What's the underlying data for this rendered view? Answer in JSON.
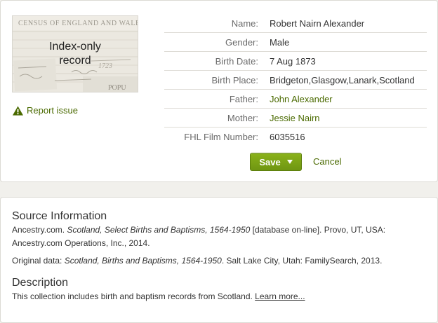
{
  "thumbnail": {
    "label": "Index-only record",
    "census_text": "CENSUS OF ENGLAND AND WALES,",
    "scrap_text_1": "POPU",
    "scrap_text_2": "1723"
  },
  "report": {
    "label": "Report issue",
    "icon": "warning-icon"
  },
  "record": {
    "fields": [
      {
        "label": "Name:",
        "value": "Robert Nairn Alexander",
        "link": false
      },
      {
        "label": "Gender:",
        "value": "Male",
        "link": false
      },
      {
        "label": "Birth Date:",
        "value": "7 Aug 1873",
        "link": false
      },
      {
        "label": "Birth Place:",
        "value": "Bridgeton,Glasgow,Lanark,Scotland",
        "link": false
      },
      {
        "label": "Father:",
        "value": "John Alexander",
        "link": true
      },
      {
        "label": "Mother:",
        "value": "Jessie Nairn",
        "link": true
      },
      {
        "label": "FHL Film Number:",
        "value": "6035516",
        "link": false
      }
    ]
  },
  "actions": {
    "save_label": "Save",
    "cancel_label": "Cancel"
  },
  "source": {
    "heading": "Source Information",
    "citation_prefix": "Ancestry.com. ",
    "citation_title": "Scotland, Select Births and Baptisms, 1564-1950",
    "citation_suffix": " [database on-line]. Provo, UT, USA: Ancestry.com Operations, Inc., 2014.",
    "original_prefix": "Original data: ",
    "original_title": "Scotland, Births and Baptisms, 1564-1950",
    "original_suffix": ". Salt Lake City, Utah: FamilySearch, 2013."
  },
  "description": {
    "heading": "Description",
    "text": "This collection includes birth and baptism records from Scotland. ",
    "learn_more": "Learn more..."
  },
  "colors": {
    "accent_green": "#4a6a00",
    "button_green": "#7aa214",
    "background": "#f1f0ec"
  }
}
